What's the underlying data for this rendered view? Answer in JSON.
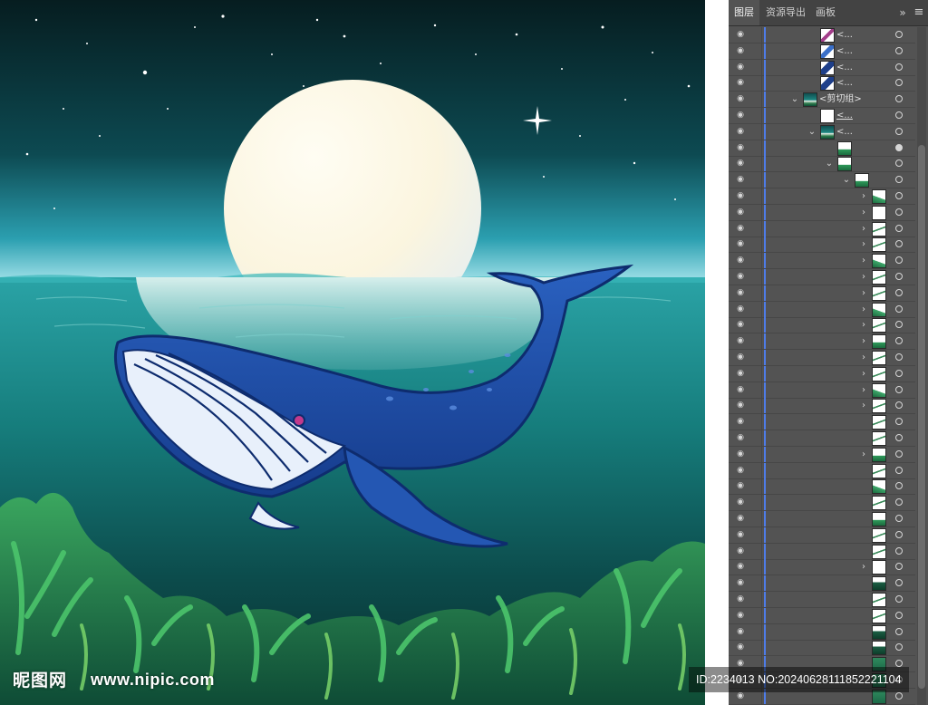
{
  "panel": {
    "tabs": [
      {
        "label": "图层",
        "active": true
      },
      {
        "label": "资源导出",
        "active": false
      },
      {
        "label": "画板",
        "active": false
      }
    ],
    "collapse_glyph": "»",
    "menu_glyph": "≡"
  },
  "layers": [
    {
      "indent": 3,
      "expander": "none",
      "thumb": "whale-pink",
      "label": "<...",
      "target": "empty"
    },
    {
      "indent": 3,
      "expander": "none",
      "thumb": "whale-blue",
      "label": "<...",
      "target": "empty"
    },
    {
      "indent": 3,
      "expander": "none",
      "thumb": "whale-dark",
      "label": "<...",
      "target": "empty"
    },
    {
      "indent": 3,
      "expander": "none",
      "thumb": "whale-dark",
      "label": "<...",
      "target": "empty"
    },
    {
      "indent": 2,
      "expander": "down",
      "thumb": "scene",
      "label": "<剪切组>",
      "target": "empty"
    },
    {
      "indent": 3,
      "expander": "none",
      "thumb": "white",
      "label": "<...",
      "target": "empty",
      "selected": true
    },
    {
      "indent": 3,
      "expander": "down",
      "thumb": "scene",
      "label": "<...",
      "target": "empty"
    },
    {
      "indent": 4,
      "expander": "none",
      "thumb": "seaweed",
      "label": "",
      "target": "filled"
    },
    {
      "indent": 4,
      "expander": "down",
      "thumb": "seaweed",
      "label": "",
      "target": "empty"
    },
    {
      "indent": 5,
      "expander": "down",
      "thumb": "seaweed",
      "label": "",
      "target": "empty"
    },
    {
      "indent": 6,
      "expander": "right",
      "thumb": "seaweed2",
      "label": "",
      "target": "empty"
    },
    {
      "indent": 6,
      "expander": "right",
      "thumb": "white",
      "label": "",
      "target": "empty"
    },
    {
      "indent": 6,
      "expander": "right",
      "thumb": "stroke",
      "label": "",
      "target": "empty"
    },
    {
      "indent": 6,
      "expander": "right",
      "thumb": "stroke",
      "label": "",
      "target": "empty"
    },
    {
      "indent": 6,
      "expander": "right",
      "thumb": "seaweed2",
      "label": "",
      "target": "empty"
    },
    {
      "indent": 6,
      "expander": "right",
      "thumb": "stroke",
      "label": "",
      "target": "empty"
    },
    {
      "indent": 6,
      "expander": "right",
      "thumb": "stroke",
      "label": "",
      "target": "empty"
    },
    {
      "indent": 6,
      "expander": "right",
      "thumb": "seaweed2",
      "label": "",
      "target": "empty"
    },
    {
      "indent": 6,
      "expander": "right",
      "thumb": "stroke",
      "label": "",
      "target": "empty"
    },
    {
      "indent": 6,
      "expander": "right",
      "thumb": "seaweed",
      "label": "",
      "target": "empty"
    },
    {
      "indent": 6,
      "expander": "right",
      "thumb": "stroke",
      "label": "",
      "target": "empty"
    },
    {
      "indent": 6,
      "expander": "right",
      "thumb": "stroke",
      "label": "",
      "target": "empty"
    },
    {
      "indent": 6,
      "expander": "right",
      "thumb": "seaweed2",
      "label": "",
      "target": "empty"
    },
    {
      "indent": 6,
      "expander": "right",
      "thumb": "stroke",
      "label": "",
      "target": "empty"
    },
    {
      "indent": 6,
      "expander": "none",
      "thumb": "stroke",
      "label": "",
      "target": "empty"
    },
    {
      "indent": 6,
      "expander": "none",
      "thumb": "stroke",
      "label": "",
      "target": "empty"
    },
    {
      "indent": 6,
      "expander": "right",
      "thumb": "seaweed",
      "label": "",
      "target": "empty"
    },
    {
      "indent": 6,
      "expander": "none",
      "thumb": "stroke",
      "label": "",
      "target": "empty"
    },
    {
      "indent": 6,
      "expander": "none",
      "thumb": "seaweed2",
      "label": "",
      "target": "empty"
    },
    {
      "indent": 6,
      "expander": "none",
      "thumb": "stroke",
      "label": "",
      "target": "empty"
    },
    {
      "indent": 6,
      "expander": "none",
      "thumb": "seaweed",
      "label": "",
      "target": "empty"
    },
    {
      "indent": 6,
      "expander": "none",
      "thumb": "stroke",
      "label": "",
      "target": "empty"
    },
    {
      "indent": 6,
      "expander": "none",
      "thumb": "stroke",
      "label": "",
      "target": "empty"
    },
    {
      "indent": 6,
      "expander": "right",
      "thumb": "white",
      "label": "",
      "target": "empty"
    },
    {
      "indent": 6,
      "expander": "none",
      "thumb": "dark",
      "label": "",
      "target": "empty"
    },
    {
      "indent": 6,
      "expander": "none",
      "thumb": "stroke",
      "label": "",
      "target": "empty"
    },
    {
      "indent": 6,
      "expander": "none",
      "thumb": "stroke",
      "label": "",
      "target": "empty"
    },
    {
      "indent": 6,
      "expander": "none",
      "thumb": "dark",
      "label": "",
      "target": "empty"
    },
    {
      "indent": 6,
      "expander": "none",
      "thumb": "dark",
      "label": "",
      "target": "empty"
    },
    {
      "indent": 6,
      "expander": "none",
      "thumb": "full",
      "label": "",
      "target": "empty"
    },
    {
      "indent": 6,
      "expander": "none",
      "thumb": "full",
      "label": "",
      "target": "empty"
    },
    {
      "indent": 6,
      "expander": "none",
      "thumb": "full",
      "label": "",
      "target": "empty"
    },
    {
      "indent": 6,
      "expander": "none",
      "thumb": "full",
      "label": "",
      "target": "empty"
    },
    {
      "indent": 6,
      "expander": "none",
      "thumb": "full",
      "label": "",
      "target": "empty"
    }
  ],
  "watermark": {
    "logo": "昵图网",
    "url": "www.nipic.com",
    "id": "ID:2234013 NO:20240628111852221104"
  },
  "colors": {
    "panel_bg": "#535353",
    "layer_color_bar": "#4e7ce8",
    "sky_top": "#0a2a2c",
    "sea": "#1b8f8c",
    "whale": "#1e4fa8"
  }
}
